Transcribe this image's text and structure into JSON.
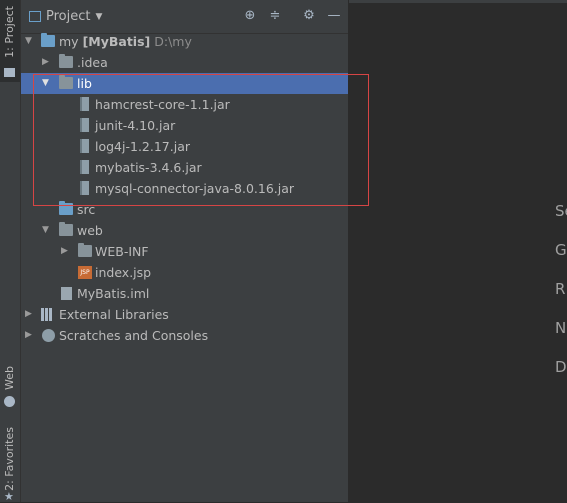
{
  "strip": {
    "project_tab": "1: Project",
    "web_tab": "Web",
    "favorites_tab": "2: Favorites"
  },
  "header": {
    "title": "Project",
    "icons": [
      "target-icon",
      "collapse-icon",
      "gear-icon",
      "minimize-icon"
    ]
  },
  "tree": {
    "root_name": "my",
    "root_module": "[MyBatis]",
    "root_path": "D:\\my",
    "idea": ".idea",
    "lib": "lib",
    "jars": [
      "hamcrest-core-1.1.jar",
      "junit-4.10.jar",
      "log4j-1.2.17.jar",
      "mybatis-3.4.6.jar",
      "mysql-connector-java-8.0.16.jar"
    ],
    "src": "src",
    "web": "web",
    "webinf": "WEB-INF",
    "index": "index.jsp",
    "iml": "MyBatis.iml",
    "external": "External Libraries",
    "scratches": "Scratches and Consoles"
  },
  "editor": {
    "letters": [
      "Se",
      "G",
      "R",
      "N",
      "D"
    ]
  },
  "colors": {
    "selection": "#4b6eaf",
    "highlight_box": "#d64545"
  }
}
